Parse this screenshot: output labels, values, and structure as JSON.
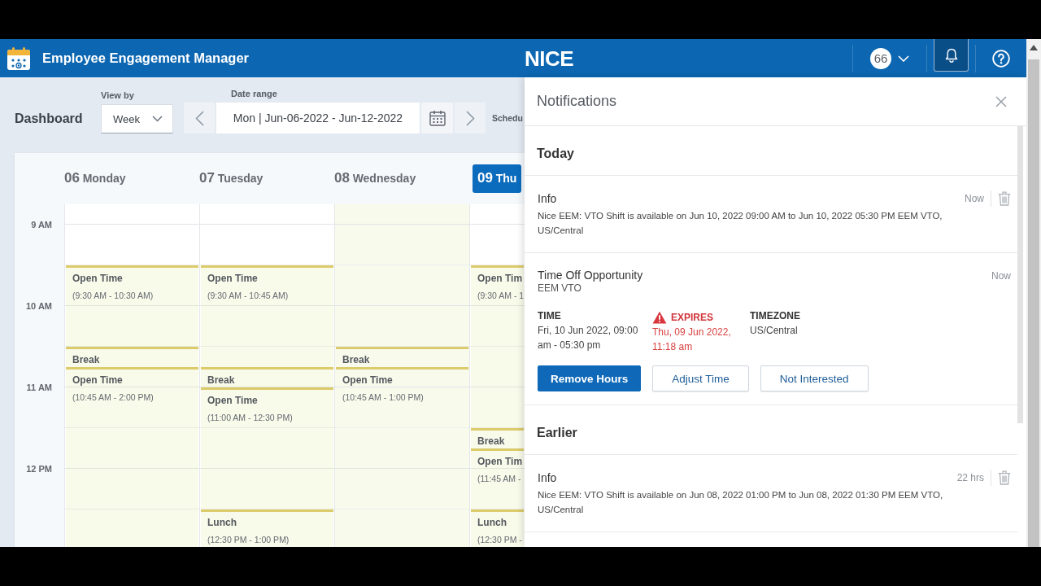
{
  "header": {
    "app_title": "Employee Engagement Manager",
    "logo_text": "NICE",
    "avatar_text": "66",
    "bell_selected": true
  },
  "toolbar": {
    "title": "Dashboard",
    "view_by": {
      "label": "View by",
      "value": "Week"
    },
    "date_range": {
      "label": "Date range",
      "value": "Mon | Jun-06-2022 - Jun-12-2022"
    },
    "cut_label": "Schedu"
  },
  "calendar": {
    "time_labels": [
      "9 AM",
      "10 AM",
      "11 AM",
      "12 PM"
    ],
    "days": [
      {
        "number": "06",
        "name": "Monday",
        "selected": false,
        "shaded": false,
        "events": [
          {
            "title": "Open Time",
            "time": "(9:30 AM - 10:30 AM)"
          },
          {
            "title": "Break"
          },
          {
            "title": "Open Time",
            "time": "(10:45 AM - 2:00 PM)"
          }
        ]
      },
      {
        "number": "07",
        "name": "Tuesday",
        "selected": false,
        "shaded": false,
        "events": [
          {
            "title": "Open Time",
            "time": "(9:30 AM - 10:45 AM)"
          },
          {
            "title": "Break"
          },
          {
            "title": "Open Time",
            "time": "(11:00 AM - 12:30 PM)"
          },
          {
            "title": "Lunch",
            "time": "(12:30 PM - 1:00 PM)"
          }
        ]
      },
      {
        "number": "08",
        "name": "Wednesday",
        "selected": false,
        "shaded": true,
        "events": [
          {
            "title": "Break"
          },
          {
            "title": "Open Time",
            "time": "(10:45 AM - 1:00 PM)"
          }
        ]
      },
      {
        "number": "09",
        "name": "Thu",
        "selected": true,
        "shaded": false,
        "events": [
          {
            "title": "Open Tim",
            "time": "(9:30 AM - 1"
          },
          {
            "title": "Break"
          },
          {
            "title": "Open Tim",
            "time": "(11:45 AM -"
          },
          {
            "title": "Lunch",
            "time": "(12:30 PM -"
          }
        ]
      }
    ]
  },
  "notifications": {
    "title": "Notifications",
    "sections": [
      {
        "title": "Today",
        "items": [
          {
            "kind": "info",
            "title": "Info",
            "age": "Now",
            "deletable": true,
            "body": "Nice EEM: VTO Shift is available on Jun 10, 2022 09:00 AM to Jun 10, 2022 05:30 PM EEM VTO, US/Central"
          },
          {
            "kind": "opportunity",
            "title": "Time Off Opportunity",
            "subtitle": "EEM VTO",
            "age": "Now",
            "deletable": false,
            "fields": [
              {
                "label": "TIME",
                "value": "Fri, 10 Jun 2022, 09:00 am - 05:30 pm",
                "warning": false
              },
              {
                "label": "EXPIRES",
                "value": "Thu, 09 Jun 2022, 11:18 am",
                "warning": true
              },
              {
                "label": "TIMEZONE",
                "value": "US/Central",
                "warning": false
              }
            ],
            "actions": [
              {
                "label": "Remove Hours",
                "primary": true
              },
              {
                "label": "Adjust Time",
                "primary": false
              },
              {
                "label": "Not Interested",
                "primary": false
              }
            ]
          }
        ]
      },
      {
        "title": "Earlier",
        "items": [
          {
            "kind": "info",
            "title": "Info",
            "age": "22 hrs",
            "deletable": true,
            "body": "Nice EEM: VTO Shift is available on Jun 08, 2022 01:00 PM to Jun 08, 2022 01:30 PM EEM VTO, US/Central"
          }
        ]
      }
    ]
  }
}
